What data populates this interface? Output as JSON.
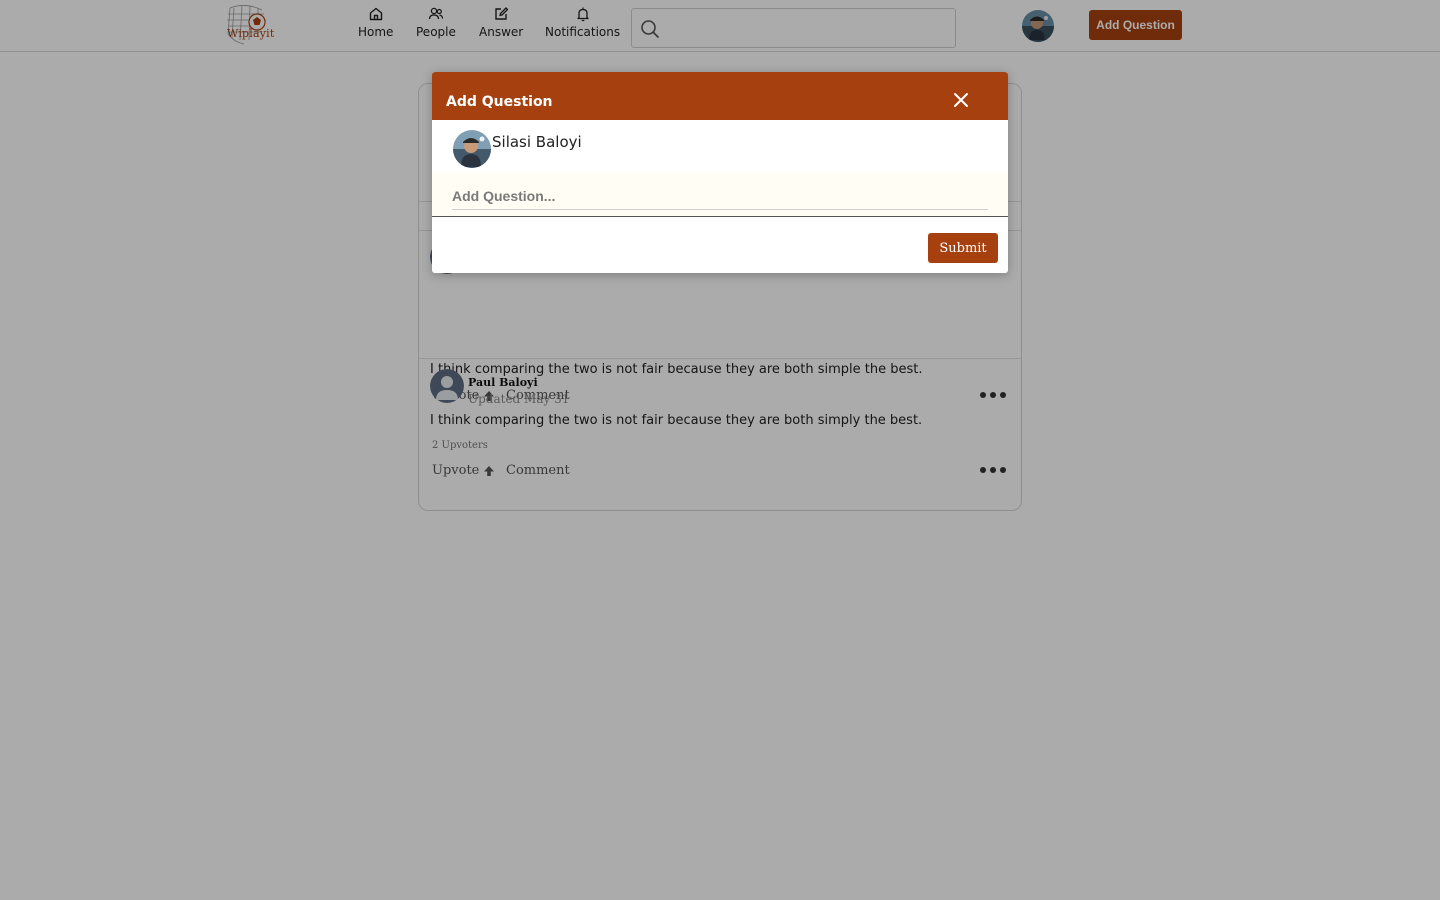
{
  "app": {
    "logo_text": "Wiplayit"
  },
  "nav": {
    "items": [
      {
        "label": "Home",
        "icon": "home-icon"
      },
      {
        "label": "People",
        "icon": "people-icon"
      },
      {
        "label": "Answer",
        "icon": "edit-icon"
      },
      {
        "label": "Notifications",
        "icon": "bell-icon"
      }
    ]
  },
  "search": {
    "placeholder": "",
    "value": ""
  },
  "header": {
    "add_question_label": "Add Question"
  },
  "feed": {
    "answers": [
      {
        "text": "I think comparing the two is not fair because they are both simple the best.",
        "upvote_label": "Upvote",
        "comment_label": "Comment"
      },
      {
        "author": "Paul Baloyi",
        "date": "Updated May 31",
        "text": "I think comparing the two is not fair because they are both simply the best.",
        "upvoters": "2 Upvoters",
        "upvote_label": "Upvote",
        "comment_label": "Comment"
      }
    ]
  },
  "modal": {
    "title": "Add Question",
    "user_name": "Silasi Baloyi",
    "question_placeholder": "Add Question...",
    "question_value": "",
    "submit_label": "Submit"
  },
  "colors": {
    "brand": "#a6410f",
    "overlay": "rgba(0,0,0,0.33)"
  }
}
